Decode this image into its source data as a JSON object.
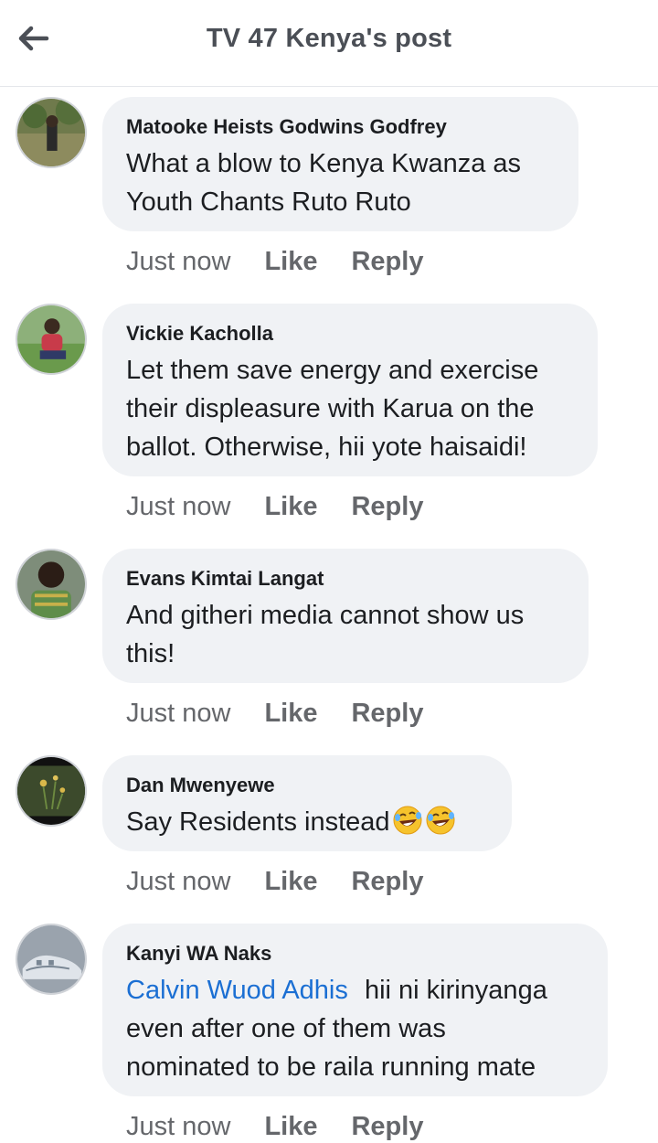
{
  "header": {
    "back_icon": "arrow-left-icon",
    "title": "TV 47 Kenya's post"
  },
  "colors": {
    "bubble": "#f0f2f5",
    "mention": "#1b6fd3",
    "meta_text": "#65676b",
    "body_text": "#1c1e21"
  },
  "comments": [
    {
      "author": "Matooke Heists Godwins Godfrey",
      "lines": [
        "What a blow to Kenya Kwanza as",
        "Youth Chants Ruto Ruto"
      ],
      "time": "Just now",
      "like": "Like",
      "reply": "Reply"
    },
    {
      "author": "Vickie Kacholla",
      "lines": [
        "Let them save energy and exercise",
        "their displeasure with Karua on the",
        "ballot. Otherwise, hii yote haisaidi!"
      ],
      "time": "Just now",
      "like": "Like",
      "reply": "Reply"
    },
    {
      "author": "Evans Kimtai Langat",
      "lines": [
        "And githeri media cannot show us",
        "this!"
      ],
      "time": "Just now",
      "like": "Like",
      "reply": "Reply"
    },
    {
      "author": "Dan Mwenyewe",
      "lines": [
        "Say Residents instead"
      ],
      "emoji": [
        "rolling-on-floor-laughing-emoji",
        "rolling-on-floor-laughing-emoji"
      ],
      "time": "Just now",
      "like": "Like",
      "reply": "Reply"
    },
    {
      "author": "Kanyi WA Naks",
      "mention": "Calvin Wuod Adhis",
      "lines": [
        "hii ni kirinyanga",
        "even after one of them was",
        "nominated to be raila running mate"
      ],
      "time": "Just now",
      "like": "Like",
      "reply": "Reply"
    }
  ]
}
